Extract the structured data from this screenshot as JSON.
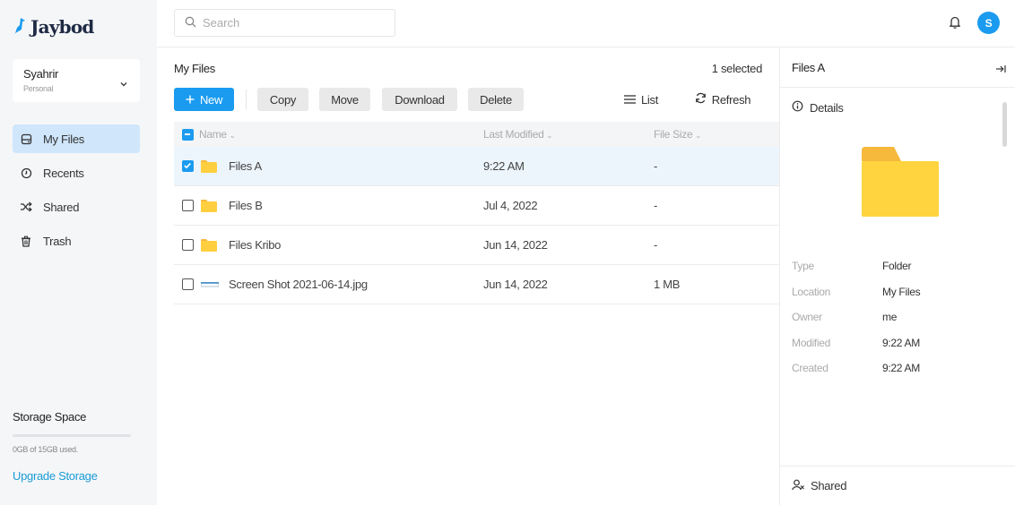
{
  "brand": {
    "name": "Jaybod"
  },
  "user": {
    "name": "Syahrir",
    "role": "Personal"
  },
  "sidebar": {
    "items": [
      {
        "label": "My Files",
        "icon": "hard-drive-icon",
        "active": true
      },
      {
        "label": "Recents",
        "icon": "clock-icon",
        "active": false
      },
      {
        "label": "Shared",
        "icon": "shuffle-icon",
        "active": false
      },
      {
        "label": "Trash",
        "icon": "trash-icon",
        "active": false
      }
    ],
    "storage": {
      "title": "Storage Space",
      "used_text": "0GB of 15GB used.",
      "used_fraction": 0.0,
      "upgrade_label": "Upgrade Storage"
    }
  },
  "topbar": {
    "search_placeholder": "Search",
    "avatar_initial": "S"
  },
  "files": {
    "title": "My Files",
    "selected_count": "1 selected",
    "toolbar": {
      "new_label": "New",
      "copy_label": "Copy",
      "move_label": "Move",
      "download_label": "Download",
      "delete_label": "Delete",
      "list_label": "List",
      "refresh_label": "Refresh"
    },
    "columns": {
      "name": "Name",
      "modified": "Last Modified",
      "size": "File Size"
    },
    "rows": [
      {
        "name": "Files A",
        "modified": "9:22 AM",
        "size": "-",
        "type": "folder",
        "selected": true
      },
      {
        "name": "Files B",
        "modified": "Jul 4, 2022",
        "size": "-",
        "type": "folder",
        "selected": false
      },
      {
        "name": "Files Kribo",
        "modified": "Jun 14, 2022",
        "size": "-",
        "type": "folder",
        "selected": false
      },
      {
        "name": "Screen Shot 2021-06-14.jpg",
        "modified": "Jun 14, 2022",
        "size": "1 MB",
        "type": "image",
        "selected": false
      }
    ]
  },
  "details": {
    "title": "Files A",
    "section_label": "Details",
    "props": [
      {
        "key": "Type",
        "value": "Folder"
      },
      {
        "key": "Location",
        "value": "My Files"
      },
      {
        "key": "Owner",
        "value": "me"
      },
      {
        "key": "Modified",
        "value": "9:22 AM"
      },
      {
        "key": "Created",
        "value": "9:22 AM"
      }
    ],
    "footer_label": "Shared"
  },
  "colors": {
    "accent": "#1a9bf0",
    "folder": "#ffcf3f",
    "folder_tab": "#f6b93b",
    "nav_active": "#cfe6fb"
  }
}
